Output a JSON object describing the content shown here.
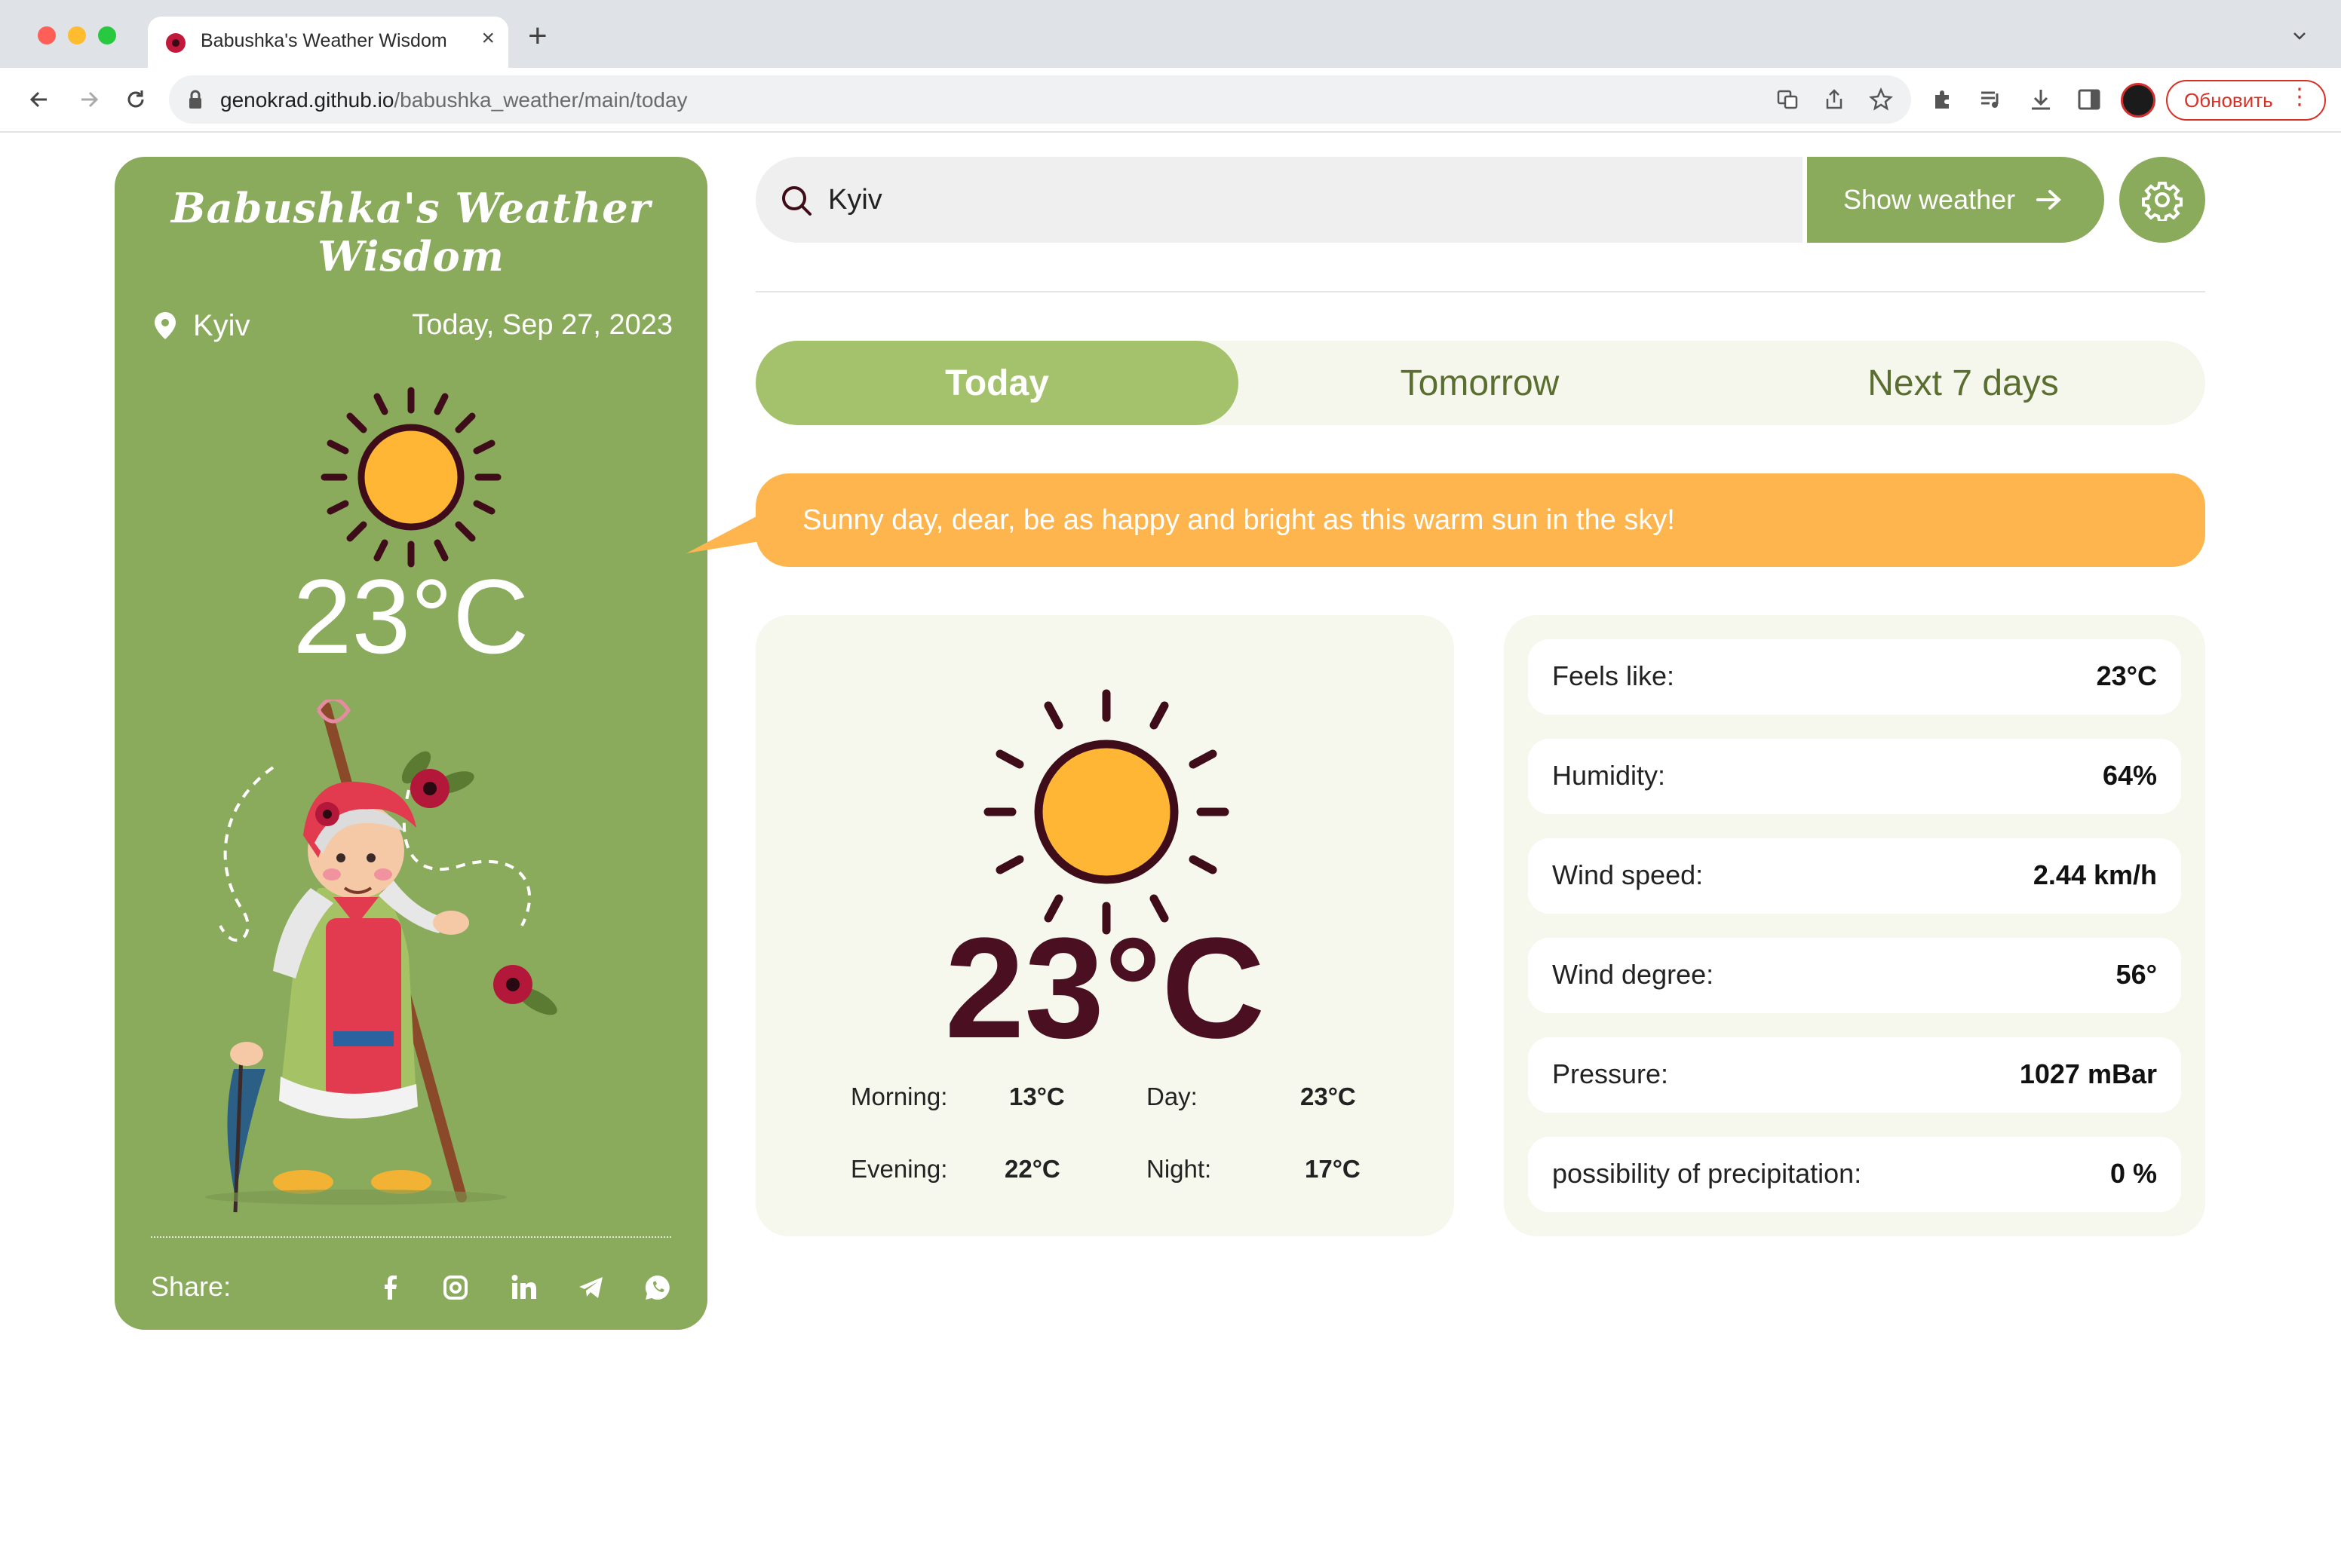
{
  "browser": {
    "tab_title": "Babushka's Weather Wisdom",
    "tab_close": "×",
    "new_tab": "+",
    "url_domain": "genokrad.github.io",
    "url_path": "/babushka_weather/main/today",
    "update_label": "Обновить",
    "update_dots": "⋮"
  },
  "sidebar": {
    "brand": "Babushka's Weather Wisdom",
    "city": "Kyiv",
    "date": "Today, Sep 27, 2023",
    "temperature": "23°C",
    "share_label": "Share:",
    "share_icons": [
      "facebook-icon",
      "instagram-icon",
      "linkedin-icon",
      "telegram-icon",
      "whatsapp-icon"
    ]
  },
  "search": {
    "value": "Kyiv",
    "button_label": "Show weather"
  },
  "tabs": [
    {
      "label": "Today",
      "active": true
    },
    {
      "label": "Tomorrow",
      "active": false
    },
    {
      "label": "Next 7 days",
      "active": false
    }
  ],
  "wisdom": "Sunny day, dear, be as happy and bright as this warm sun in the sky!",
  "forecast": {
    "temperature": "23°C",
    "morning_label": "Morning:",
    "morning_value": "13°C",
    "day_label": "Day:",
    "day_value": "23°C",
    "evening_label": "Evening:",
    "evening_value": "22°C",
    "night_label": "Night:",
    "night_value": "17°C"
  },
  "details": [
    {
      "label": "Feels like:",
      "value": "23°C"
    },
    {
      "label": "Humidity:",
      "value": "64%"
    },
    {
      "label": "Wind speed:",
      "value": "2.44 km/h"
    },
    {
      "label": "Wind degree:",
      "value": "56°"
    },
    {
      "label": "Pressure:",
      "value": "1027 mBar"
    },
    {
      "label": "possibility of precipitation:",
      "value": "0 %"
    }
  ],
  "colors": {
    "card_green": "#8aaa5c",
    "tab_active": "#a3c26b",
    "bubble_orange": "#ffb54d",
    "temp_dark": "#4a1022",
    "sun_yellow": "#ffb634"
  }
}
